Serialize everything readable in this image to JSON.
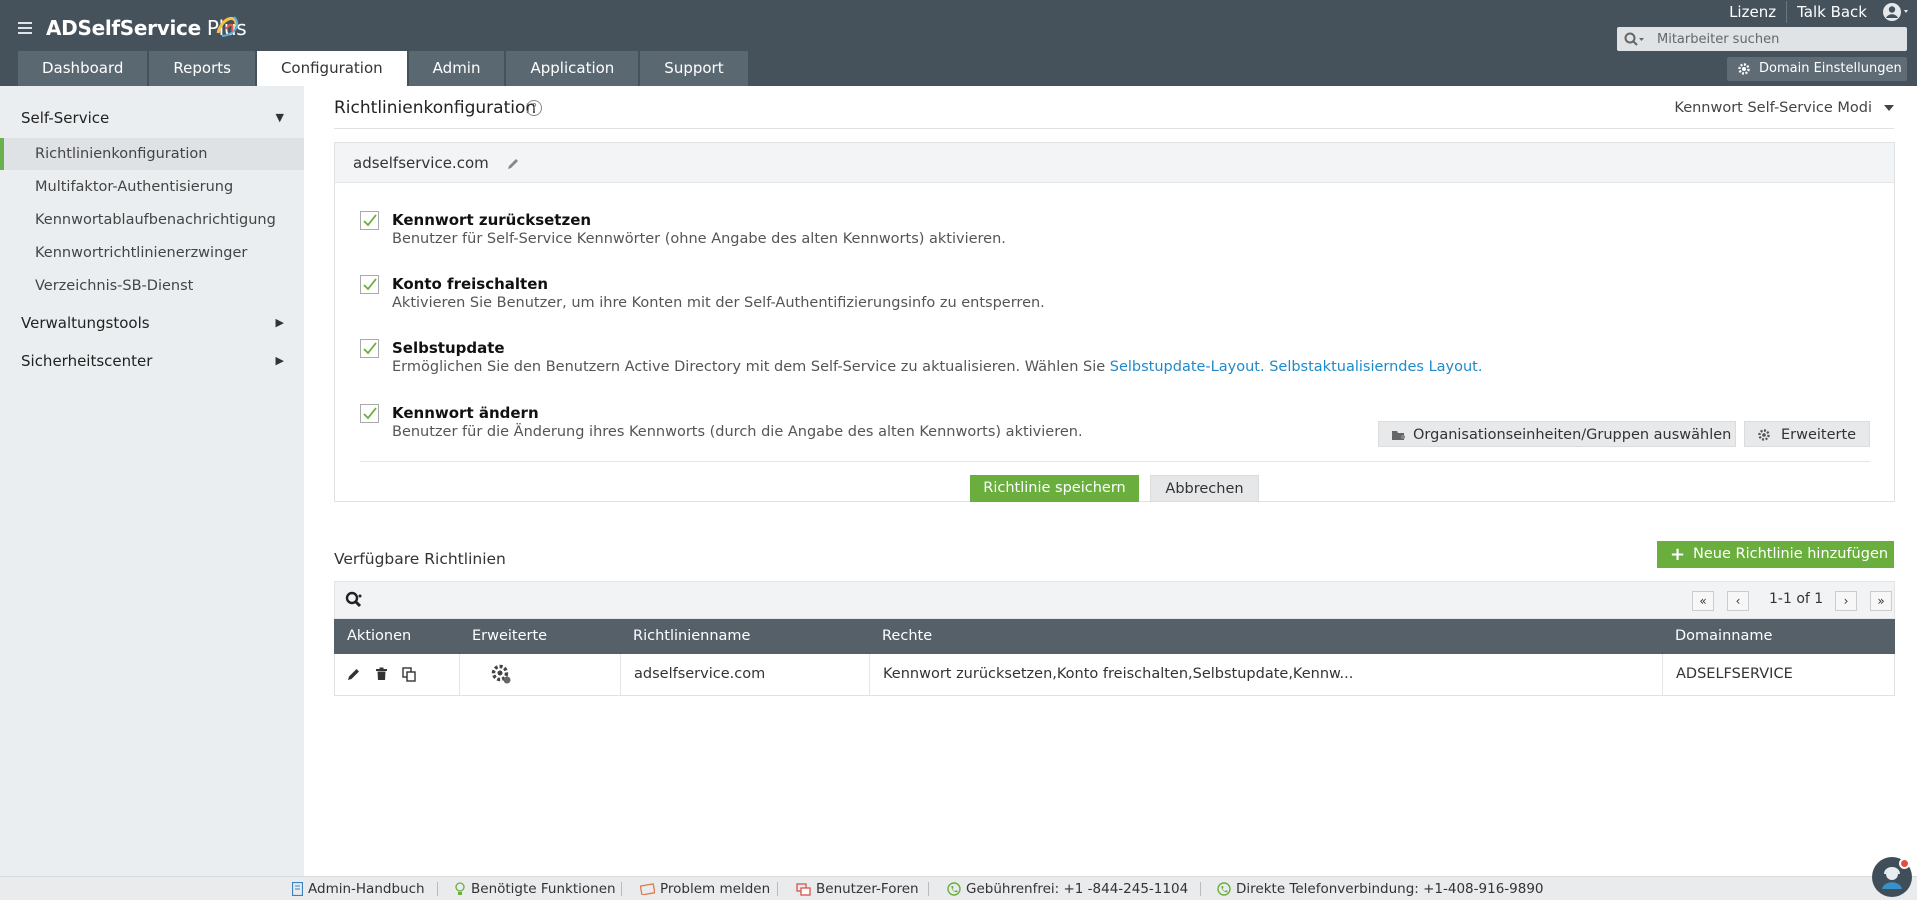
{
  "header": {
    "app_name": "ADSelfService",
    "app_name_plus": " Plus",
    "tabs": [
      "Dashboard",
      "Reports",
      "Configuration",
      "Admin",
      "Application",
      "Support"
    ],
    "active_tab": "Configuration",
    "links": [
      "Lizenz",
      "Talk Back"
    ],
    "search_placeholder": "Mitarbeiter suchen",
    "domain_button": "Domain Einstellungen"
  },
  "sidebar": {
    "section_self_service": "Self-Service",
    "items": [
      "Richtlinienkonfiguration",
      "Multifaktor-Authentisierung",
      "Kennwortablaufbenachrichtigung",
      "Kennwortrichtlinienerzwinger",
      "Verzeichnis-SB-Dienst"
    ],
    "active_item": "Richtlinienkonfiguration",
    "section_tools": "Verwaltungstools",
    "section_security": "Sicherheitscenter"
  },
  "main": {
    "title": "Richtlinienkonfiguration",
    "help": "?",
    "mode_select": "Kennwort Self-Service Modi",
    "policy_domain": "adselfservice.com",
    "options": [
      {
        "title": "Kennwort zurücksetzen",
        "desc": "Benutzer für Self-Service Kennwörter (ohne Angabe des alten Kennworts) aktivieren.",
        "checked": true
      },
      {
        "title": "Konto freischalten",
        "desc": "Aktivieren Sie Benutzer, um ihre Konten mit der Self-Authentifizierungsinfo zu entsperren.",
        "checked": true
      },
      {
        "title": "Selbstupdate",
        "desc": "Ermöglichen Sie den Benutzern Active Directory mit dem Self-Service zu aktualisieren. Wählen Sie ",
        "checked": true
      },
      {
        "title": "Kennwort ändern",
        "desc": "Benutzer für die Änderung ihres Kennworts (durch die Angabe des alten Kennworts) aktivieren.",
        "checked": true
      }
    ],
    "link1": "Selbstupdate-Layout.",
    "link2": "Selbstaktualisierndes Layout.",
    "ou_button": "Organisationseinheiten/Gruppen auswählen",
    "advanced_button": "Erweiterte",
    "save_button": "Richtlinie speichern",
    "cancel_button": "Abbrechen",
    "available_title": "Verfügbare Richtlinien",
    "new_policy_button": "Neue Richtlinie hinzufügen",
    "pagination": "1-1 of 1",
    "columns": [
      "Aktionen",
      "Erweiterte",
      "Richtlinienname",
      "Rechte",
      "Domainname"
    ],
    "rows": [
      {
        "name": "adselfservice.com",
        "rights": "Kennwort zurücksetzen,Konto freischalten,Selbstupdate,Kennw...",
        "domain": "ADSELFSERVICE"
      }
    ]
  },
  "footer": {
    "items": [
      "Admin-Handbuch",
      "Benötigte Funktionen",
      "Problem melden",
      "Benutzer-Foren",
      "Gebührenfrei: +1 -844-245-1104",
      "Direkte Telefonverbindung: +1-408-916-9890"
    ]
  },
  "colors": {
    "header_bg": "#45515b",
    "accent_green": "#6aaf3d",
    "link_blue": "#1f8ac9",
    "table_head": "#556069"
  }
}
